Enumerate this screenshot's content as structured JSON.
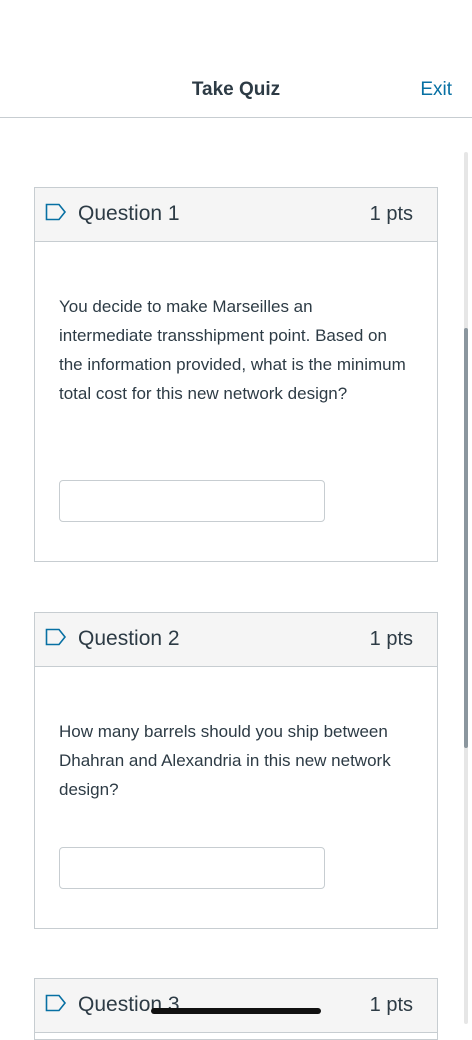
{
  "header": {
    "title": "Take Quiz",
    "exit_label": "Exit"
  },
  "questions": [
    {
      "name": "Question 1",
      "points": "1 pts",
      "text": "You decide to make Marseilles an intermediate transshipment point.  Based on the information provided, what is the minimum total cost for this new network design?",
      "answer_value": ""
    },
    {
      "name": "Question 2",
      "points": "1 pts",
      "text": "How many barrels should you ship between Dhahran and Alexandria in this new network design?",
      "answer_value": ""
    },
    {
      "name": "Question 3",
      "points": "1 pts"
    }
  ],
  "colors": {
    "link": "#0770a3",
    "text": "#2d3b45",
    "border": "#c7cdd1",
    "header_bg": "#f5f5f5"
  },
  "icons": {
    "flag": "flag-question-icon"
  }
}
